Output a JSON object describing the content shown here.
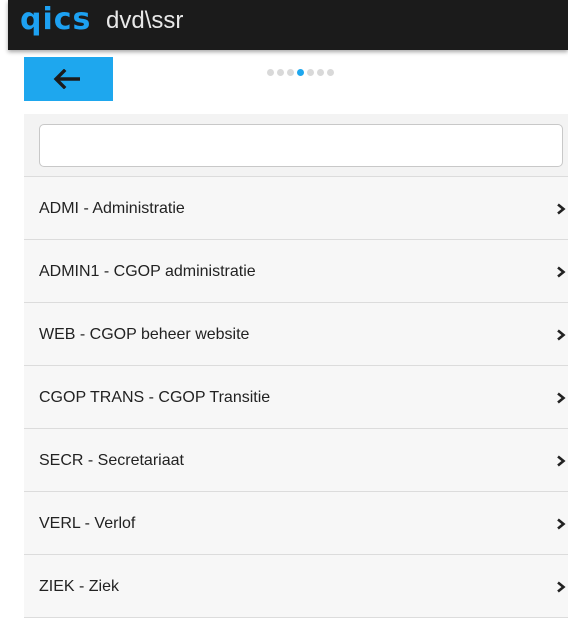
{
  "header": {
    "logo_text": "qics",
    "user": "dvd\\ssr"
  },
  "pager": {
    "count": 7,
    "active_index": 3
  },
  "search": {
    "value": "",
    "placeholder": ""
  },
  "items": [
    {
      "label": "ADMI - Administratie"
    },
    {
      "label": "ADMIN1 - CGOP administratie"
    },
    {
      "label": "WEB - CGOP beheer website"
    },
    {
      "label": "CGOP TRANS - CGOP Transitie"
    },
    {
      "label": "SECR - Secretariaat"
    },
    {
      "label": "VERL - Verlof"
    },
    {
      "label": "ZIEK - Ziek"
    }
  ],
  "icons": {
    "back": "arrow-left-icon",
    "item": "chevron-right-icon"
  },
  "colors": {
    "accent": "#1ea7ee",
    "topbar": "#1b1b1b",
    "logo": "#1da1f2"
  }
}
